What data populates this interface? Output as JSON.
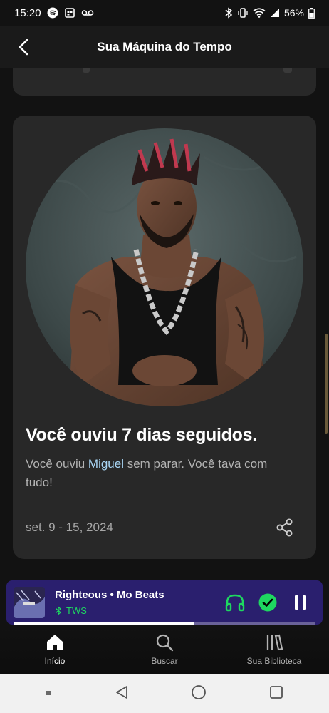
{
  "status_bar": {
    "time": "15:20",
    "battery": "56%"
  },
  "header": {
    "title": "Sua Máquina do Tempo",
    "back_icon": "chevron-left-icon"
  },
  "card": {
    "title": "Você ouviu 7 dias seguidos.",
    "desc_prefix": "Você ouviu ",
    "artist": "Miguel",
    "desc_suffix": " sem parar. Você tava com tudo!",
    "date": "set. 9 - 15, 2024",
    "share_icon": "share-icon"
  },
  "now_playing": {
    "title": "Righteous • Mo Beats",
    "device": "TWS",
    "progress": 0.6,
    "accent": "#1ed760",
    "background": "#2a1f6e"
  },
  "bottom_nav": {
    "items": [
      {
        "label": "Início",
        "icon": "home-icon"
      },
      {
        "label": "Buscar",
        "icon": "search-icon"
      },
      {
        "label": "Sua Biblioteca",
        "icon": "library-icon"
      }
    ]
  }
}
